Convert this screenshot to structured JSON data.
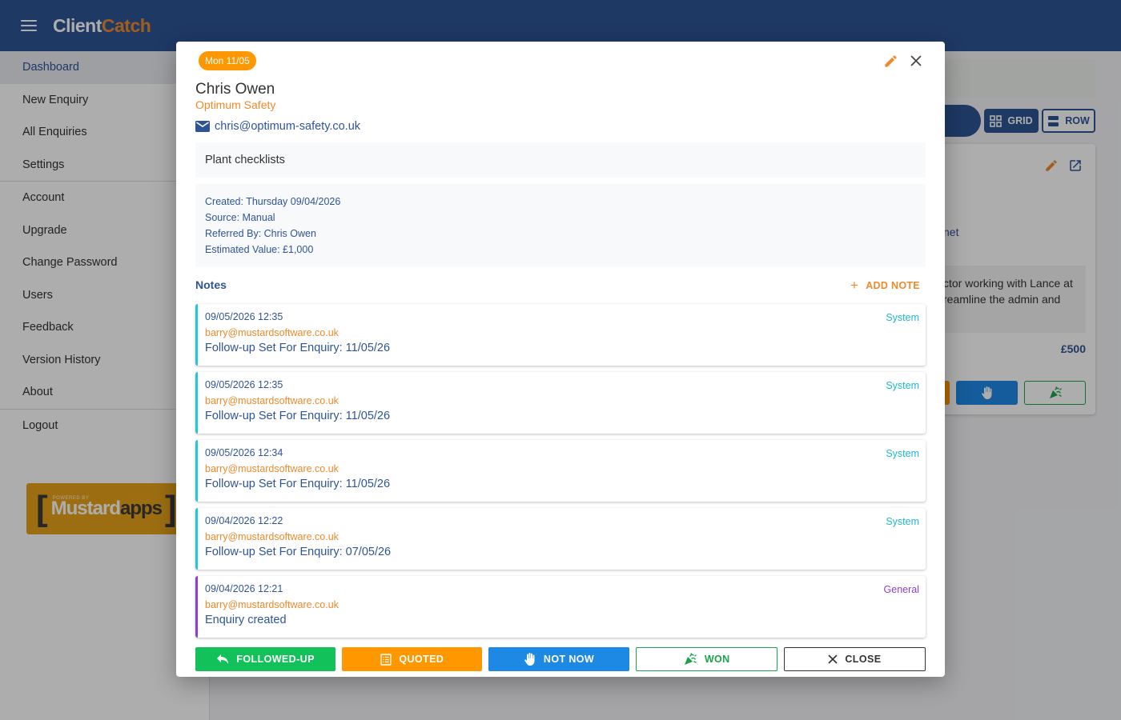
{
  "app": {
    "brand_part1": "Client",
    "brand_part2": "Catch",
    "accent": "#ef8a2b",
    "primary": "#2f5496"
  },
  "sidebar": {
    "items": [
      {
        "label": "Dashboard",
        "active": true
      },
      {
        "label": "New Enquiry"
      },
      {
        "label": "All Enquiries"
      },
      {
        "label": "Settings"
      },
      {
        "label": "Account"
      },
      {
        "label": "Upgrade"
      },
      {
        "label": "Change Password"
      },
      {
        "label": "Users"
      },
      {
        "label": "Feedback"
      },
      {
        "label": "Version History"
      },
      {
        "label": "About"
      },
      {
        "label": "Logout"
      }
    ],
    "powered_small": "POWERED BY",
    "powered_name1": "Mustard",
    "powered_name2": "apps"
  },
  "view_toggle": {
    "grid_label": "GRID",
    "row_label": "ROW"
  },
  "background_card": {
    "email_fragment": "net",
    "desc_line1": "ctor working with Lance at",
    "desc_line2": "reamline the admin and",
    "value": "£500"
  },
  "modal": {
    "date_chip": "Mon 11/05",
    "name": "Chris Owen",
    "company": "Optimum Safety",
    "email": "chris@optimum-safety.co.uk",
    "description": "Plant checklists",
    "meta": {
      "created": "Created: Thursday 09/04/2026",
      "source": "Source: Manual",
      "referred_by": "Referred By: Chris Owen",
      "estimated_value": "Estimated Value: £1,000"
    },
    "notes_heading": "Notes",
    "add_note_label": "ADD NOTE",
    "notes": [
      {
        "date": "09/05/2026 12:35",
        "type": "System",
        "user": "barry@mustardsoftware.co.uk",
        "text": "Follow-up Set For Enquiry: 11/05/26"
      },
      {
        "date": "09/05/2026 12:35",
        "type": "System",
        "user": "barry@mustardsoftware.co.uk",
        "text": "Follow-up Set For Enquiry: 11/05/26"
      },
      {
        "date": "09/05/2026 12:34",
        "type": "System",
        "user": "barry@mustardsoftware.co.uk",
        "text": "Follow-up Set For Enquiry: 11/05/26"
      },
      {
        "date": "09/04/2026 12:22",
        "type": "System",
        "user": "barry@mustardsoftware.co.uk",
        "text": "Follow-up Set For Enquiry: 07/05/26"
      },
      {
        "date": "09/04/2026 12:21",
        "type": "General",
        "user": "barry@mustardsoftware.co.uk",
        "text": "Enquiry created"
      }
    ],
    "actions": {
      "followed_up": "FOLLOWED-UP",
      "quoted": "QUOTED",
      "not_now": "NOT NOW",
      "won": "WON",
      "close": "CLOSE"
    }
  }
}
